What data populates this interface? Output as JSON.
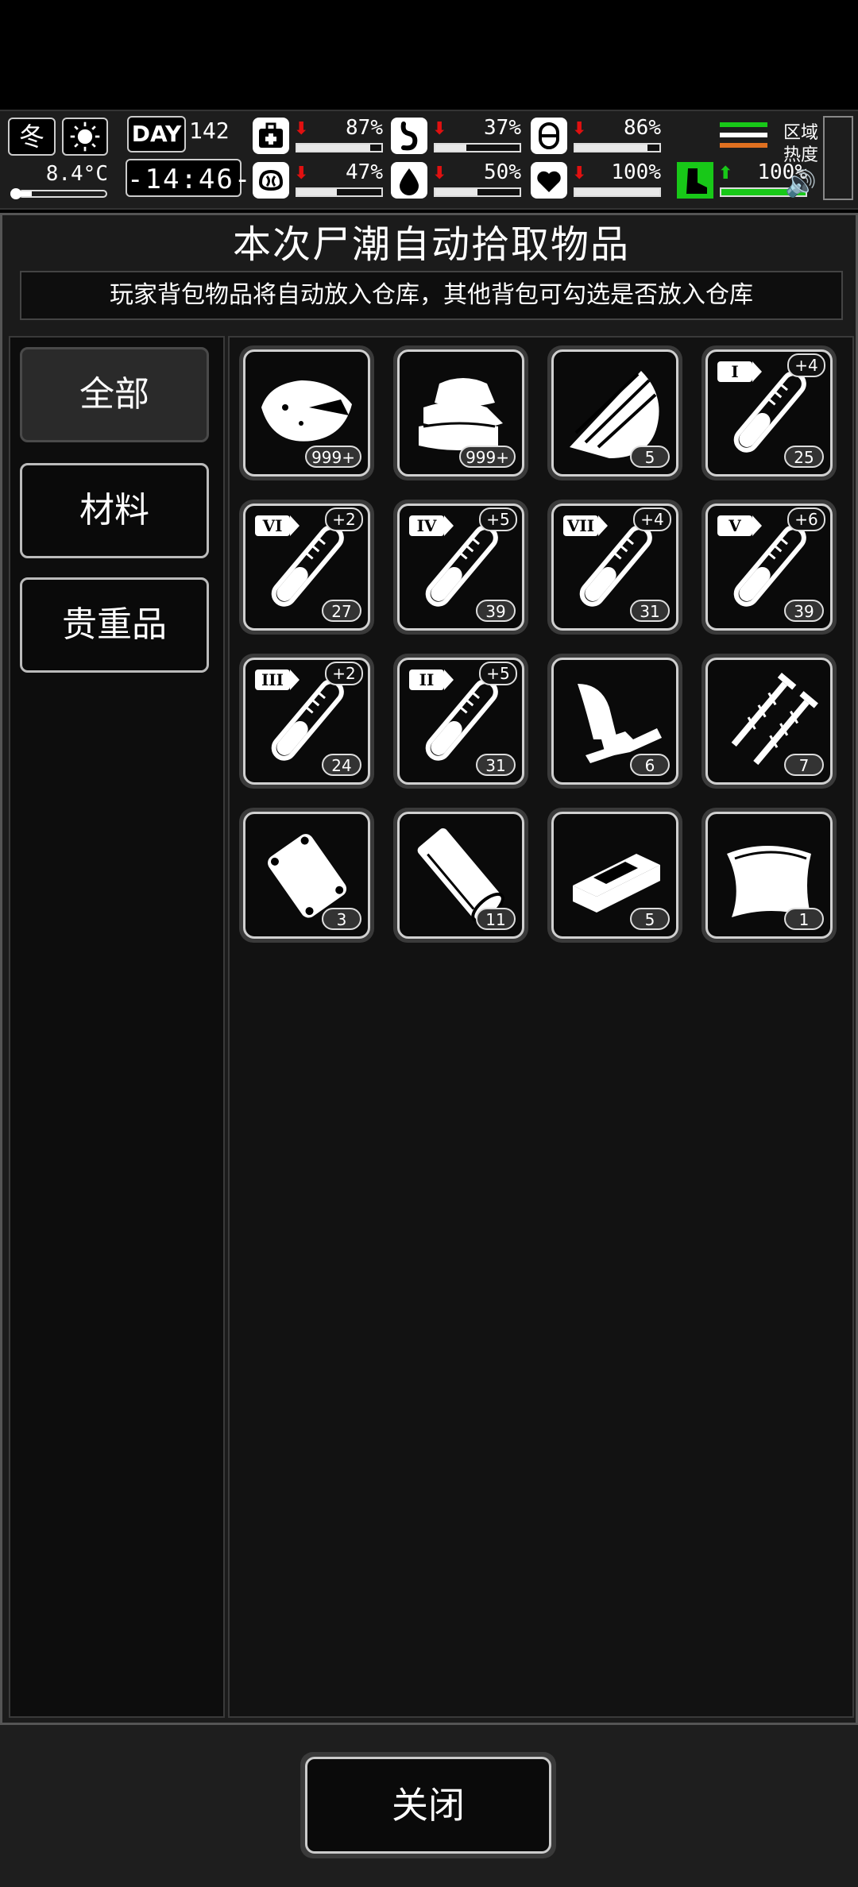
{
  "hud": {
    "season": "冬",
    "temperature": "8.4°C",
    "day_label": "DAY",
    "day_number": "142",
    "clock": "-14:46-",
    "stats": [
      {
        "name": "health",
        "icon": "medkit-icon",
        "value": "87%",
        "trend": "down",
        "fill": 0.87
      },
      {
        "name": "hunger",
        "icon": "stomach-icon",
        "value": "37%",
        "trend": "down",
        "fill": 0.37
      },
      {
        "name": "stamina",
        "icon": "pill-icon",
        "value": "86%",
        "trend": "down",
        "fill": 0.86
      },
      {
        "name": "mood",
        "icon": "brain-icon",
        "value": "47%",
        "trend": "down",
        "fill": 0.47
      },
      {
        "name": "thirst",
        "icon": "water-drop-icon",
        "value": "50%",
        "trend": "down",
        "fill": 0.5
      },
      {
        "name": "heart",
        "icon": "heart-icon",
        "value": "100%",
        "trend": "down",
        "fill": 1.0
      },
      {
        "name": "speed",
        "icon": "boot-icon",
        "value": "100%",
        "trend": "up",
        "fill": 1.0
      }
    ],
    "region_label": "区域热度",
    "speed_colors": [
      "#18c818",
      "#ffffff",
      "#e07020"
    ]
  },
  "panel": {
    "title": "本次尸潮自动拾取物品",
    "notice": "玩家背包物品将自动放入仓库，其他背包可勾选是否放入仓库",
    "categories": [
      {
        "label": "全部",
        "active": true
      },
      {
        "label": "材料",
        "active": false
      },
      {
        "label": "贵重品",
        "active": false
      }
    ],
    "items": [
      {
        "icon": "rock-ore-icon",
        "count": "999+",
        "tier": "",
        "bonus": ""
      },
      {
        "icon": "cloth-stack-icon",
        "count": "999+",
        "tier": "",
        "bonus": ""
      },
      {
        "icon": "wood-planks-icon",
        "count": "5",
        "tier": "",
        "bonus": ""
      },
      {
        "icon": "test-tube-icon",
        "count": "25",
        "tier": "I",
        "bonus": "+4"
      },
      {
        "icon": "test-tube-icon",
        "count": "27",
        "tier": "VI",
        "bonus": "+2"
      },
      {
        "icon": "test-tube-icon",
        "count": "39",
        "tier": "IV",
        "bonus": "+5"
      },
      {
        "icon": "test-tube-icon",
        "count": "31",
        "tier": "VII",
        "bonus": "+4"
      },
      {
        "icon": "test-tube-icon",
        "count": "39",
        "tier": "V",
        "bonus": "+6"
      },
      {
        "icon": "test-tube-icon",
        "count": "24",
        "tier": "III",
        "bonus": "+2"
      },
      {
        "icon": "test-tube-icon",
        "count": "31",
        "tier": "II",
        "bonus": "+5"
      },
      {
        "icon": "metal-scraps-icon",
        "count": "6",
        "tier": "",
        "bonus": ""
      },
      {
        "icon": "screws-icon",
        "count": "7",
        "tier": "",
        "bonus": ""
      },
      {
        "icon": "pouch-icon",
        "count": "3",
        "tier": "",
        "bonus": ""
      },
      {
        "icon": "cloth-roll-icon",
        "count": "11",
        "tier": "",
        "bonus": ""
      },
      {
        "icon": "brick-icon",
        "count": "5",
        "tier": "",
        "bonus": ""
      },
      {
        "icon": "leather-sheet-icon",
        "count": "1",
        "tier": "",
        "bonus": ""
      }
    ]
  },
  "footer": {
    "close_label": "关闭"
  }
}
